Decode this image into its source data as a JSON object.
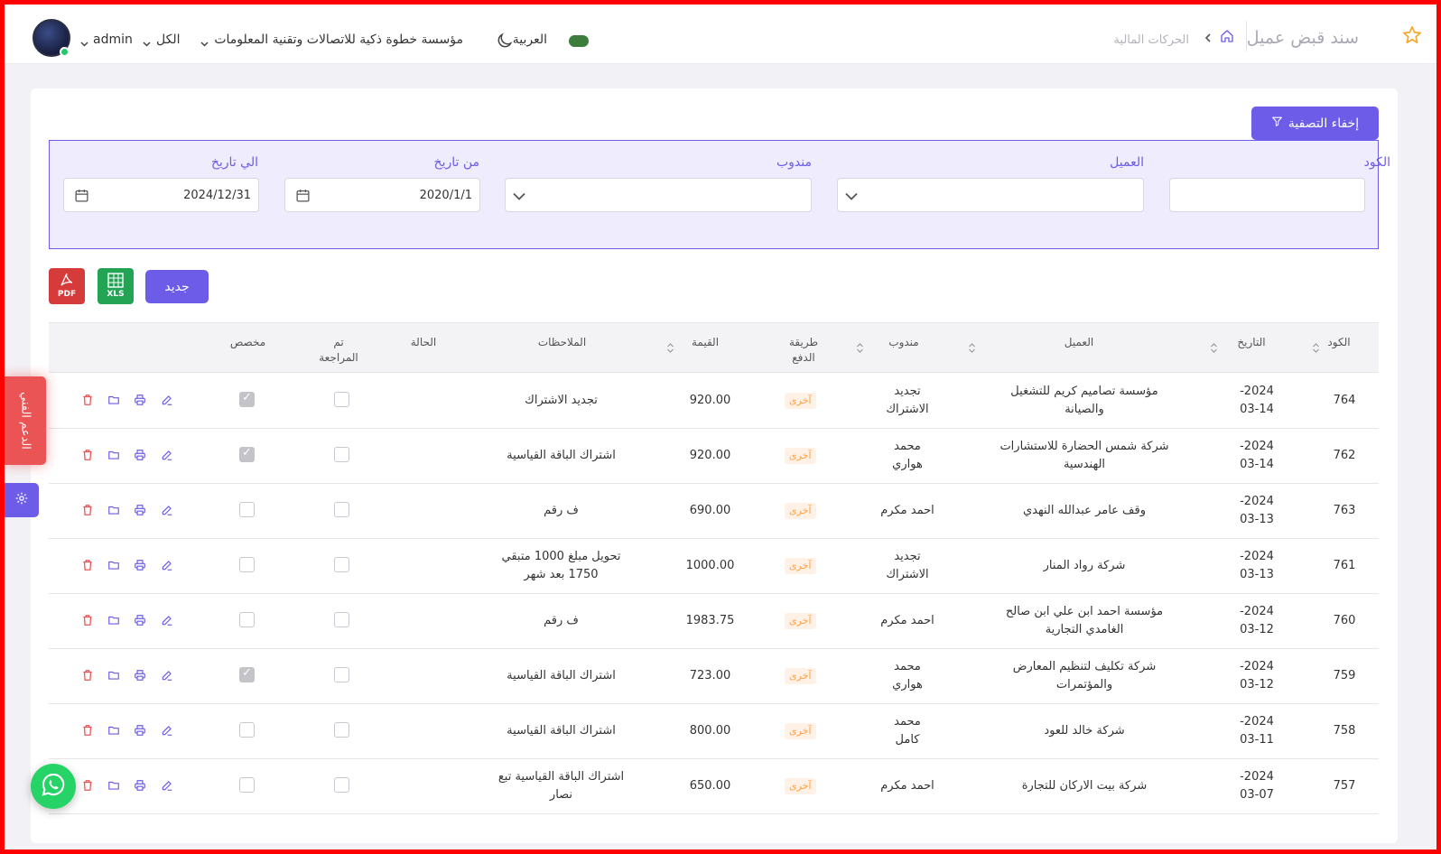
{
  "header": {
    "page_title": "سند قبض عميل",
    "breadcrumb": "الحركات المالية",
    "company": "مؤسسة خطوة ذكية للاتصالات وتقنية المعلومات",
    "branch": "الكل",
    "user": "admin",
    "language": "العربية"
  },
  "filter": {
    "toggle_label": "إخفاء التصفية",
    "code_label": "الكود",
    "code_value": "",
    "client_label": "العميل",
    "rep_label": "مندوب",
    "from_label": "من تاريخ",
    "from_value": "2020/1/1",
    "to_label": "الي تاريخ",
    "to_value": "2024/12/31"
  },
  "toolbar": {
    "new_label": "جديد",
    "pdf_label": "PDF",
    "xls_label": "XLS"
  },
  "table": {
    "headers": {
      "code": "الكود",
      "date": "التاريخ",
      "client": "العميل",
      "rep": "مندوب",
      "pay_1": "طريقة",
      "pay_2": "الدفع",
      "amount": "القيمة",
      "notes": "الملاحظات",
      "status": "الحالة",
      "reviewed_1": "تم",
      "reviewed_2": "المراجعة",
      "allocated": "مخصص"
    },
    "rows": [
      {
        "code": "764",
        "date_1": "2024-",
        "date_2": "03-14",
        "client_1": "مؤسسة تصاميم كريم للتشغيل",
        "client_2": "والصيانة",
        "rep_1": "تجديد",
        "rep_2": "الاشتراك",
        "pay": "آخرى",
        "amount": "920.00",
        "notes_1": "تجديد الاشتراك",
        "notes_2": "",
        "reviewed": false,
        "allocated": true
      },
      {
        "code": "762",
        "date_1": "2024-",
        "date_2": "03-14",
        "client_1": "شركة شمس الحضارة للاستشارات",
        "client_2": "الهندسية",
        "rep_1": "محمد",
        "rep_2": "هواري",
        "pay": "آخرى",
        "amount": "920.00",
        "notes_1": "اشتراك الباقة القياسية",
        "notes_2": "",
        "reviewed": false,
        "allocated": true
      },
      {
        "code": "763",
        "date_1": "2024-",
        "date_2": "03-13",
        "client_1": "وقف عامر عبدالله النهدي",
        "client_2": "",
        "rep_1": "احمد مكرم",
        "rep_2": "",
        "pay": "آخرى",
        "amount": "690.00",
        "notes_1": "ف رقم",
        "notes_2": "",
        "reviewed": false,
        "allocated": false
      },
      {
        "code": "761",
        "date_1": "2024-",
        "date_2": "03-13",
        "client_1": "شركة رواد المنار",
        "client_2": "",
        "rep_1": "تجديد",
        "rep_2": "الاشتراك",
        "pay": "آخرى",
        "amount": "1000.00",
        "notes_1": "تحويل مبلغ 1000 متبقي",
        "notes_2": "1750 بعد شهر",
        "reviewed": false,
        "allocated": false
      },
      {
        "code": "760",
        "date_1": "2024-",
        "date_2": "03-12",
        "client_1": "مؤسسة احمد ابن علي ابن صالح",
        "client_2": "الغامدي التجارية",
        "rep_1": "احمد مكرم",
        "rep_2": "",
        "pay": "آخرى",
        "amount": "1983.75",
        "notes_1": "ف رقم",
        "notes_2": "",
        "reviewed": false,
        "allocated": false
      },
      {
        "code": "759",
        "date_1": "2024-",
        "date_2": "03-12",
        "client_1": "شركة تكليف لتنظيم المعارض",
        "client_2": "والمؤتمرات",
        "rep_1": "محمد",
        "rep_2": "هواري",
        "pay": "آخرى",
        "amount": "723.00",
        "notes_1": "اشتراك الباقة القياسية",
        "notes_2": "",
        "reviewed": false,
        "allocated": true
      },
      {
        "code": "758",
        "date_1": "2024-",
        "date_2": "03-11",
        "client_1": "شركة خالد للعود",
        "client_2": "",
        "rep_1": "محمد",
        "rep_2": "كامل",
        "pay": "آخرى",
        "amount": "800.00",
        "notes_1": "اشتراك الباقة القياسية",
        "notes_2": "",
        "reviewed": false,
        "allocated": false
      },
      {
        "code": "757",
        "date_1": "2024-",
        "date_2": "03-07",
        "client_1": "شركة بيت الاركان للتجارة",
        "client_2": "",
        "rep_1": "احمد مكرم",
        "rep_2": "",
        "pay": "آخرى",
        "amount": "650.00",
        "notes_1": "اشتراك الباقة القياسية تبع",
        "notes_2": "نصار",
        "reviewed": false,
        "allocated": false
      }
    ]
  },
  "floating": {
    "support_label": "الدعم الفني"
  },
  "colors": {
    "accent": "#6c5ce7",
    "danger": "#ea5455",
    "badge_text": "#ff9f43",
    "badge_bg": "#fff1e5"
  },
  "icons": [
    "star-icon",
    "home-icon",
    "chevron-left-icon",
    "moon-icon",
    "flag-icon",
    "filter-icon",
    "calendar-icon",
    "chevron-down-icon",
    "sort-icon",
    "edit-icon",
    "print-icon",
    "folder-icon",
    "trash-icon",
    "gear-icon",
    "whatsapp-icon"
  ]
}
